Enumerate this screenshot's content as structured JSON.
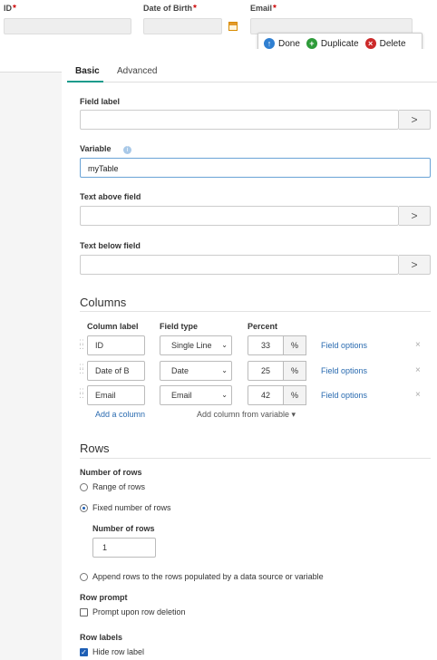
{
  "preview": {
    "fields": [
      {
        "label": "ID",
        "required": "*"
      },
      {
        "label": "Date of Birth",
        "required": "*"
      },
      {
        "label": "Email",
        "required": "*"
      }
    ],
    "actions": {
      "done": "Done",
      "duplicate": "Duplicate",
      "delete": "Delete"
    },
    "icons": {
      "done": "arrow-up-icon",
      "duplicate": "plus-icon",
      "delete": "x-icon",
      "calendar": "calendar-icon"
    },
    "colors": {
      "done": "#2f7fd1",
      "duplicate": "#2e9b3a",
      "delete": "#cc2a2a"
    }
  },
  "tabs": [
    {
      "label": "Basic",
      "active": true
    },
    {
      "label": "Advanced",
      "active": false
    }
  ],
  "fields": {
    "field_label": {
      "label": "Field label",
      "value": ""
    },
    "variable": {
      "label": "Variable",
      "value": "myTable"
    },
    "text_above": {
      "label": "Text above field",
      "value": ""
    },
    "text_below": {
      "label": "Text below field",
      "value": ""
    },
    "arrow": ">"
  },
  "columns": {
    "title": "Columns",
    "headers": {
      "label": "Column label",
      "type": "Field type",
      "percent": "Percent"
    },
    "rows": [
      {
        "label": "ID",
        "type": "Single Line",
        "percent": "33",
        "pct": "%",
        "options": "Field options",
        "remove": "×"
      },
      {
        "label": "Date of B",
        "type": "Date",
        "percent": "25",
        "pct": "%",
        "options": "Field options",
        "remove": "×"
      },
      {
        "label": "Email",
        "type": "Email",
        "percent": "42",
        "pct": "%",
        "options": "Field options",
        "remove": "×"
      }
    ],
    "add_column": "Add a column",
    "add_from_variable": "Add column from variable"
  },
  "rows": {
    "title": "Rows",
    "number_of_rows": "Number of rows",
    "options": [
      {
        "label": "Range of rows",
        "selected": false
      },
      {
        "label": "Fixed number of rows",
        "selected": true
      },
      {
        "label": "Append rows to the rows populated by a data source or variable",
        "selected": false
      }
    ],
    "fixed_label": "Number of rows",
    "fixed_value": "1",
    "row_prompt": "Row prompt",
    "prompt_option": {
      "label": "Prompt upon row deletion",
      "checked": false
    },
    "row_labels": "Row labels",
    "hide_option": {
      "label": "Hide row label",
      "checked": true
    }
  }
}
